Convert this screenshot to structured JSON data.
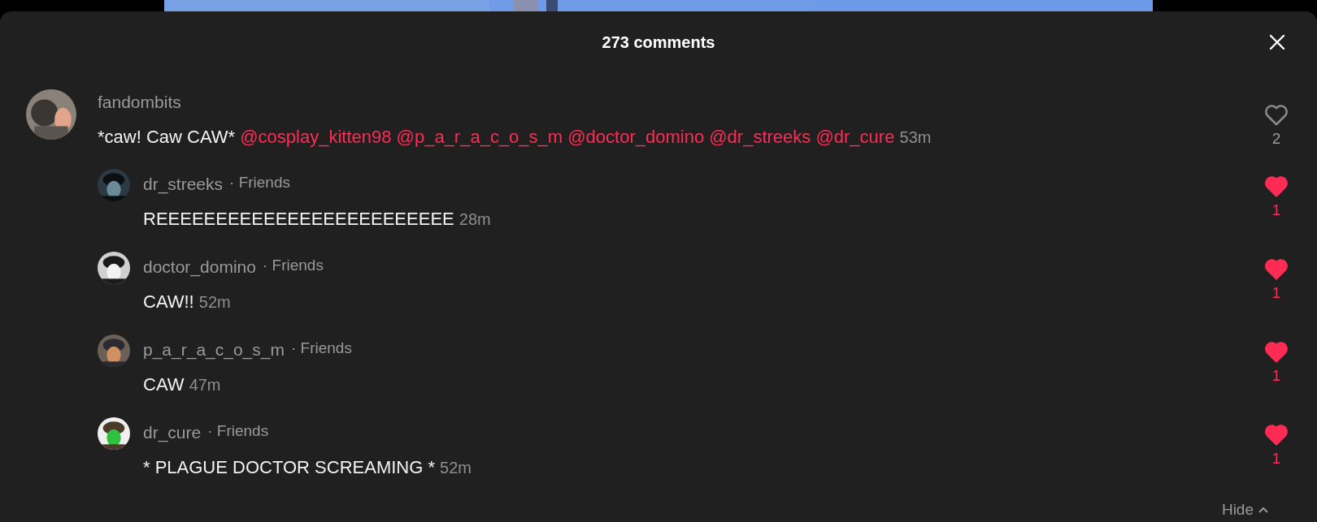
{
  "header": {
    "title": "273 comments"
  },
  "comment": {
    "username": "fandombits",
    "text": "*caw! Caw CAW*",
    "mentions": [
      "@cosplay_kitten98",
      "@p_a_r_a_c_o_s_m",
      "@doctor_domino",
      "@dr_streeks",
      "@dr_cure"
    ],
    "time": "53m",
    "liked": false,
    "likes": "2"
  },
  "replies": [
    {
      "username": "dr_streeks",
      "tag": "· Friends",
      "text": "REEEEEEEEEEEEEEEEEEEEEEEEE",
      "time": "28m",
      "liked": true,
      "likes": "1"
    },
    {
      "username": "doctor_domino",
      "tag": "· Friends",
      "text": "CAW!!",
      "time": "52m",
      "liked": true,
      "likes": "1"
    },
    {
      "username": "p_a_r_a_c_o_s_m",
      "tag": "· Friends",
      "text": "CAW",
      "time": "47m",
      "liked": true,
      "likes": "1"
    },
    {
      "username": "dr_cure",
      "tag": "· Friends",
      "text": "* PLAGUE DOCTOR SCREAMING *",
      "time": "52m",
      "liked": true,
      "likes": "1"
    }
  ],
  "hide_button": "Hide"
}
